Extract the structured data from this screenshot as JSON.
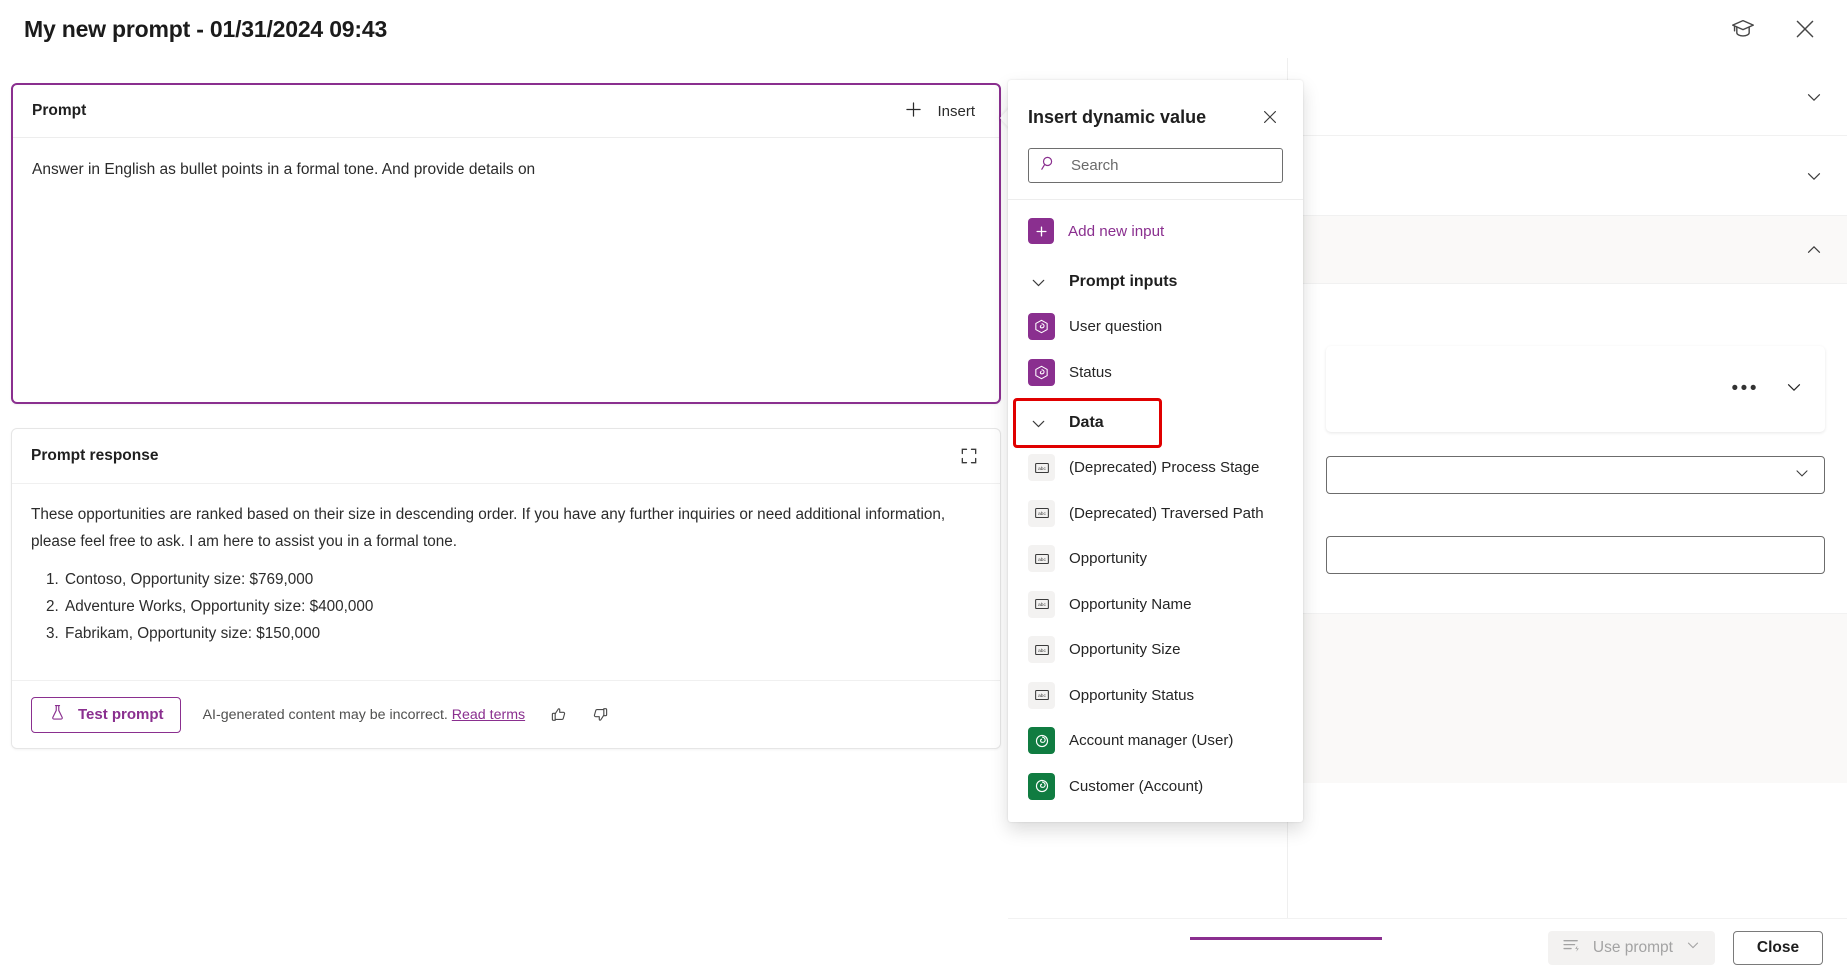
{
  "titlebar": {
    "title": "My new prompt - 01/31/2024 09:43",
    "learning_icon": "graduation-cap-icon",
    "close_icon": "close-icon"
  },
  "prompt_card": {
    "heading": "Prompt",
    "insert_label": "Insert",
    "insert_icon": "plus-icon",
    "text": "Answer in English as bullet points in a formal tone. And provide details on",
    "border_color": "#8a2f8f"
  },
  "response_card": {
    "heading": "Prompt response",
    "expand_icon": "expand-icon",
    "paragraph": "These opportunities are ranked based on their size in descending order. If you have any further inquiries or need additional information, please feel free to ask. I am here to assist you in a formal tone.",
    "list": [
      "Contoso, Opportunity size: $769,000",
      "Adventure Works, Opportunity size: $400,000",
      "Fabrikam, Opportunity size: $150,000"
    ],
    "test_button": {
      "label": "Test prompt",
      "icon": "flask-icon"
    },
    "disclaimer": "AI-generated content may be incorrect.",
    "disclaimer_link": "Read terms",
    "thumbs_up_icon": "thumbs-up-icon",
    "thumbs_down_icon": "thumbs-down-icon"
  },
  "flyout": {
    "title": "Insert dynamic value",
    "close_icon": "close-icon",
    "search": {
      "placeholder": "Search",
      "value": "",
      "icon": "search-icon"
    },
    "add_new_input": {
      "label": "Add new input",
      "icon": "plus-icon"
    },
    "groups": [
      {
        "label": "Prompt inputs",
        "chevron": "chevron-down-icon",
        "highlighted": false,
        "items": [
          {
            "label": "User question",
            "icon": "prompt-input-icon",
            "kind": "input"
          },
          {
            "label": "Status",
            "icon": "prompt-input-icon",
            "kind": "input"
          }
        ]
      },
      {
        "label": "Data",
        "chevron": "chevron-down-icon",
        "highlighted": true,
        "highlight_color": "#e00000",
        "items": [
          {
            "label": "(Deprecated) Process Stage",
            "icon": "text-field-icon",
            "kind": "abc"
          },
          {
            "label": "(Deprecated) Traversed Path",
            "icon": "text-field-icon",
            "kind": "abc"
          },
          {
            "label": "Opportunity",
            "icon": "text-field-icon",
            "kind": "abc"
          },
          {
            "label": "Opportunity Name",
            "icon": "text-field-icon",
            "kind": "abc"
          },
          {
            "label": "Opportunity Size",
            "icon": "text-field-icon",
            "kind": "abc"
          },
          {
            "label": "Opportunity Status",
            "icon": "text-field-icon",
            "kind": "abc"
          },
          {
            "label": "Account manager (User)",
            "icon": "lookup-field-icon",
            "kind": "lookup"
          },
          {
            "label": "Customer (Account)",
            "icon": "lookup-field-icon",
            "kind": "lookup"
          }
        ]
      }
    ]
  },
  "bottom_bar": {
    "use_prompt": {
      "label": "Use prompt",
      "icon": "use-prompt-icon",
      "chevron": "chevron-down-icon",
      "disabled": true
    },
    "close": {
      "label": "Close"
    }
  },
  "right_rail": {
    "sections": [
      {
        "chevron": "chevron-down-icon"
      },
      {
        "chevron": "chevron-down-icon"
      },
      {
        "chevron": "chevron-up-icon"
      }
    ],
    "subcard": {
      "ellipsis": "•••",
      "chevron": "chevron-down-icon"
    },
    "dropdown": {
      "chevron": "chevron-down-icon"
    }
  },
  "colors": {
    "accent_purple": "#8a2f8f",
    "highlight_red": "#e00000",
    "lookup_green": "#107c41"
  }
}
